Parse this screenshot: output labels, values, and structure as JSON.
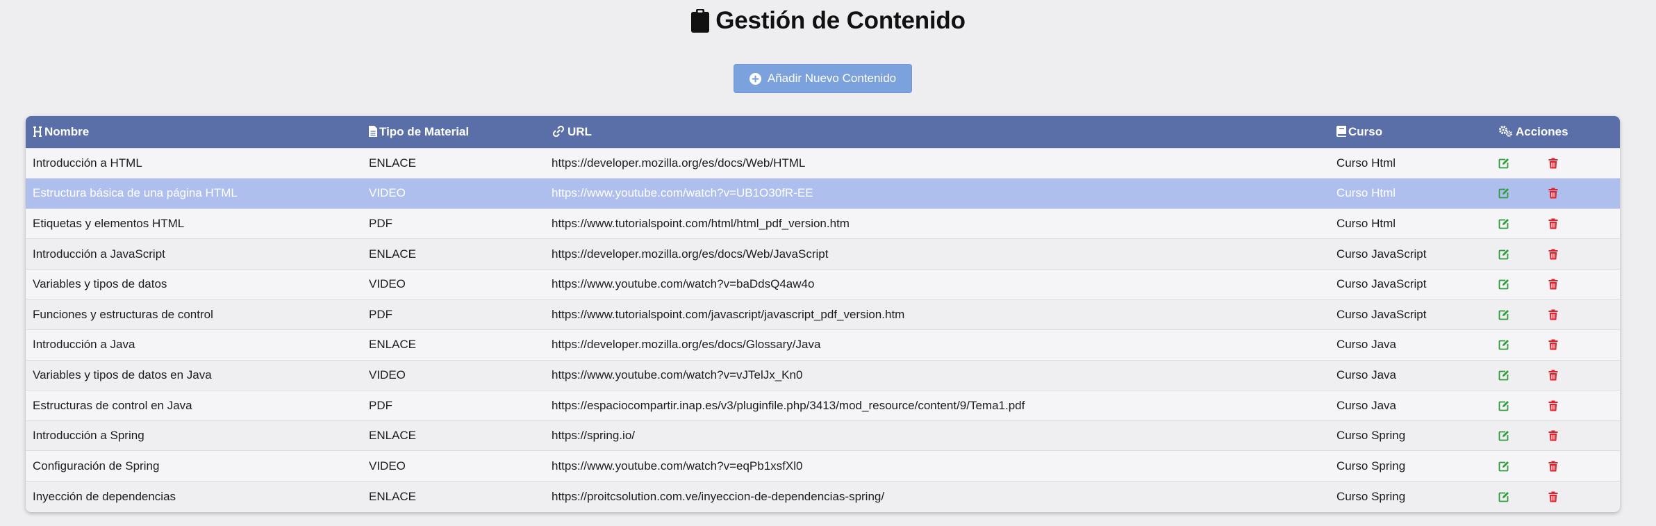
{
  "header": {
    "title": "Gestión de Contenido",
    "title_icon": "clipboard-icon"
  },
  "add_button": {
    "label": "Añadir Nuevo Contenido",
    "icon": "plus-circle-icon",
    "color": "#7ba2dc"
  },
  "table": {
    "header_color": "#5a6ea8",
    "selected_row_color": "#aebfed",
    "columns": [
      {
        "label": "Nombre",
        "icon": "heading-icon"
      },
      {
        "label": "Tipo de Material",
        "icon": "file-icon"
      },
      {
        "label": "URL",
        "icon": "link-icon"
      },
      {
        "label": "Curso",
        "icon": "book-icon"
      },
      {
        "label": "Acciones",
        "icon": "gears-icon"
      }
    ],
    "rows": [
      {
        "nombre": "Introducción a HTML",
        "tipo": "ENLACE",
        "url": "https://developer.mozilla.org/es/docs/Web/HTML",
        "curso": "Curso Html",
        "selected": false
      },
      {
        "nombre": "Estructura básica de una página HTML",
        "tipo": "VIDEO",
        "url": "https://www.youtube.com/watch?v=UB1O30fR-EE",
        "curso": "Curso Html",
        "selected": true
      },
      {
        "nombre": "Etiquetas y elementos HTML",
        "tipo": "PDF",
        "url": "https://www.tutorialspoint.com/html/html_pdf_version.htm",
        "curso": "Curso Html",
        "selected": false
      },
      {
        "nombre": "Introducción a JavaScript",
        "tipo": "ENLACE",
        "url": "https://developer.mozilla.org/es/docs/Web/JavaScript",
        "curso": "Curso JavaScript",
        "selected": false
      },
      {
        "nombre": "Variables y tipos de datos",
        "tipo": "VIDEO",
        "url": "https://www.youtube.com/watch?v=baDdsQ4aw4o",
        "curso": "Curso JavaScript",
        "selected": false
      },
      {
        "nombre": "Funciones y estructuras de control",
        "tipo": "PDF",
        "url": "https://www.tutorialspoint.com/javascript/javascript_pdf_version.htm",
        "curso": "Curso JavaScript",
        "selected": false
      },
      {
        "nombre": "Introducción a Java",
        "tipo": "ENLACE",
        "url": "https://developer.mozilla.org/es/docs/Glossary/Java",
        "curso": "Curso Java",
        "selected": false
      },
      {
        "nombre": "Variables y tipos de datos en Java",
        "tipo": "VIDEO",
        "url": "https://www.youtube.com/watch?v=vJTelJx_Kn0",
        "curso": "Curso Java",
        "selected": false
      },
      {
        "nombre": "Estructuras de control en Java",
        "tipo": "PDF",
        "url": "https://espaciocompartir.inap.es/v3/pluginfile.php/3413/mod_resource/content/9/Tema1.pdf",
        "curso": "Curso Java",
        "selected": false
      },
      {
        "nombre": "Introducción a Spring",
        "tipo": "ENLACE",
        "url": "https://spring.io/",
        "curso": "Curso Spring",
        "selected": false
      },
      {
        "nombre": "Configuración de Spring",
        "tipo": "VIDEO",
        "url": "https://www.youtube.com/watch?v=eqPb1xsfXl0",
        "curso": "Curso Spring",
        "selected": false
      },
      {
        "nombre": "Inyección de dependencias",
        "tipo": "ENLACE",
        "url": "https://proitcsolution.com.ve/inyeccion-de-dependencias-spring/",
        "curso": "Curso Spring",
        "selected": false
      }
    ],
    "row_actions": {
      "edit_icon": "edit-icon",
      "edit_color": "#2e9e3b",
      "delete_icon": "trash-icon",
      "delete_color": "#e0202a"
    }
  }
}
